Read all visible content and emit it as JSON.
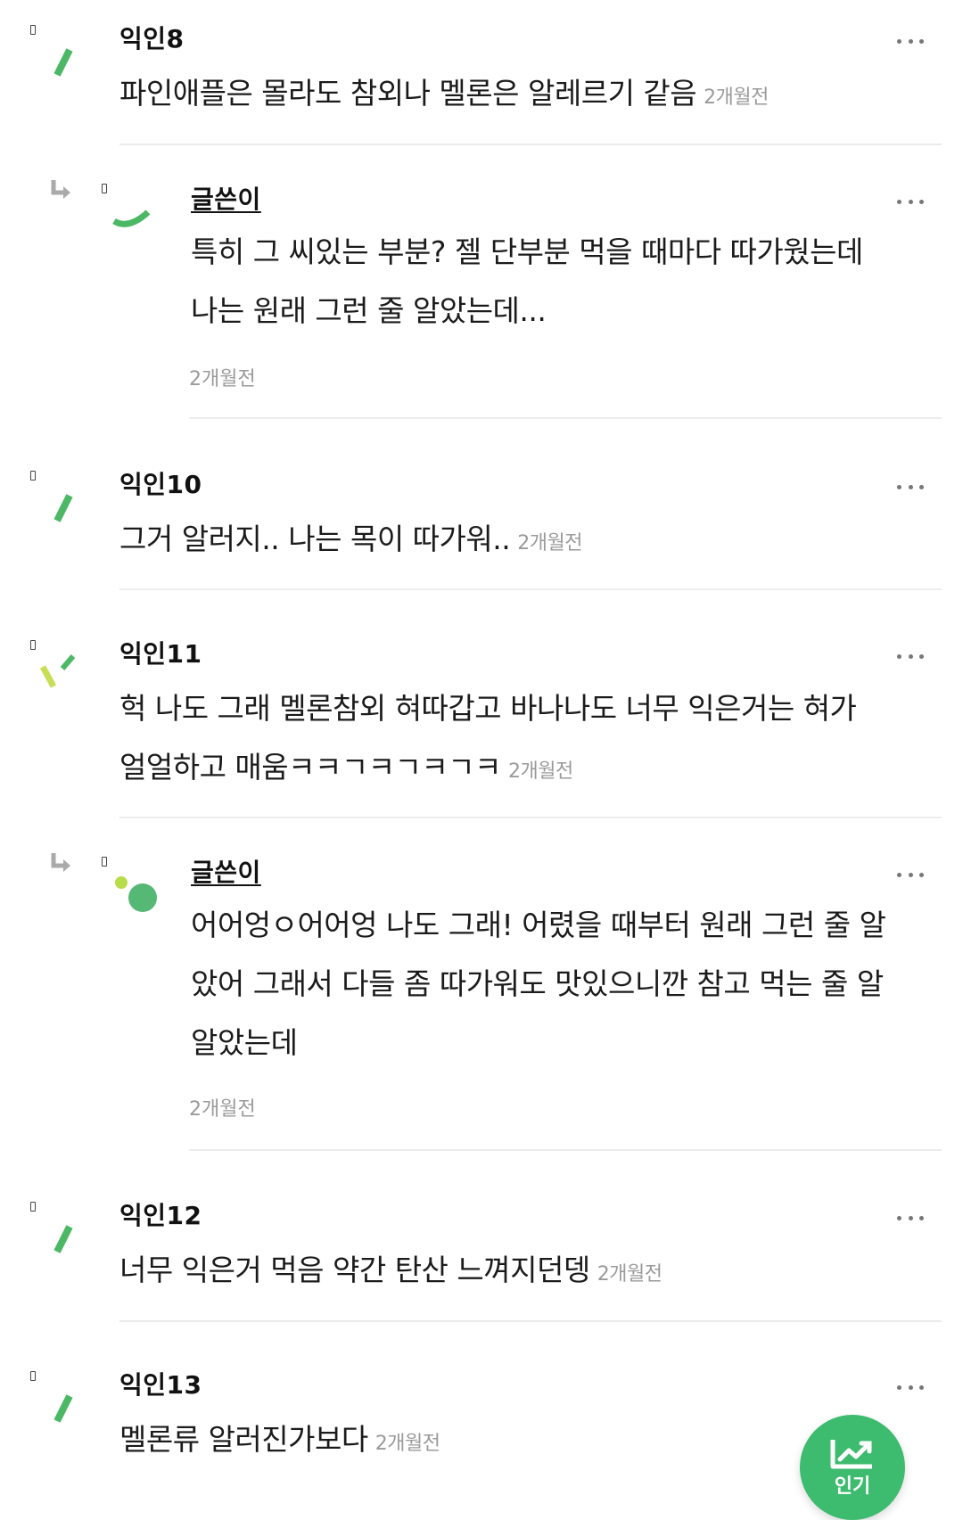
{
  "comments": [
    {
      "name": "익인8",
      "text": "파인애플은 몰라도 참외나 멜론은 알레르기 같음",
      "time": "2개월전"
    },
    {
      "name": "글쓴이",
      "text_lines": [
        "특히 그 씨있는 부분? 젤 단부분 먹을 때마다 따가웠는데",
        "나는 원래 그런 줄 알았는데..."
      ],
      "time": "2개월전"
    },
    {
      "name": "익인10",
      "text": "그거 알러지.. 나는 목이 따가워..",
      "time": "2개월전"
    },
    {
      "name": "익인11",
      "text_lines": [
        "헉 나도 그래 멜론참외 혀따갑고 바나나도 너무 익은거는 혀가",
        "얼얼하고 매움ㅋㅋㄱㅋㄱㅋㄱㅋ"
      ],
      "time": "2개월전"
    },
    {
      "name": "글쓴이",
      "text_lines": [
        "어어엉ㅇ어어엉 나도 그래! 어렸을 때부터 원래 그런 줄 알",
        "았어 그래서 다들 좀 따가워도 맛있으니깐 참고 먹는 줄 알",
        "알았는데"
      ],
      "time": "2개월전"
    },
    {
      "name": "익인12",
      "text": "너무 익은거 먹음 약간 탄산 느껴지던뎅",
      "time": "2개월전"
    },
    {
      "name": "익인13",
      "text": "멜론류 알러진가보다",
      "time": "2개월전"
    }
  ],
  "fab": {
    "label": "인기",
    "icon": "trend-chart-icon"
  },
  "colors": {
    "accent": "#3dbb6e",
    "divider": "#ececec",
    "time": "#9a9a9a"
  }
}
